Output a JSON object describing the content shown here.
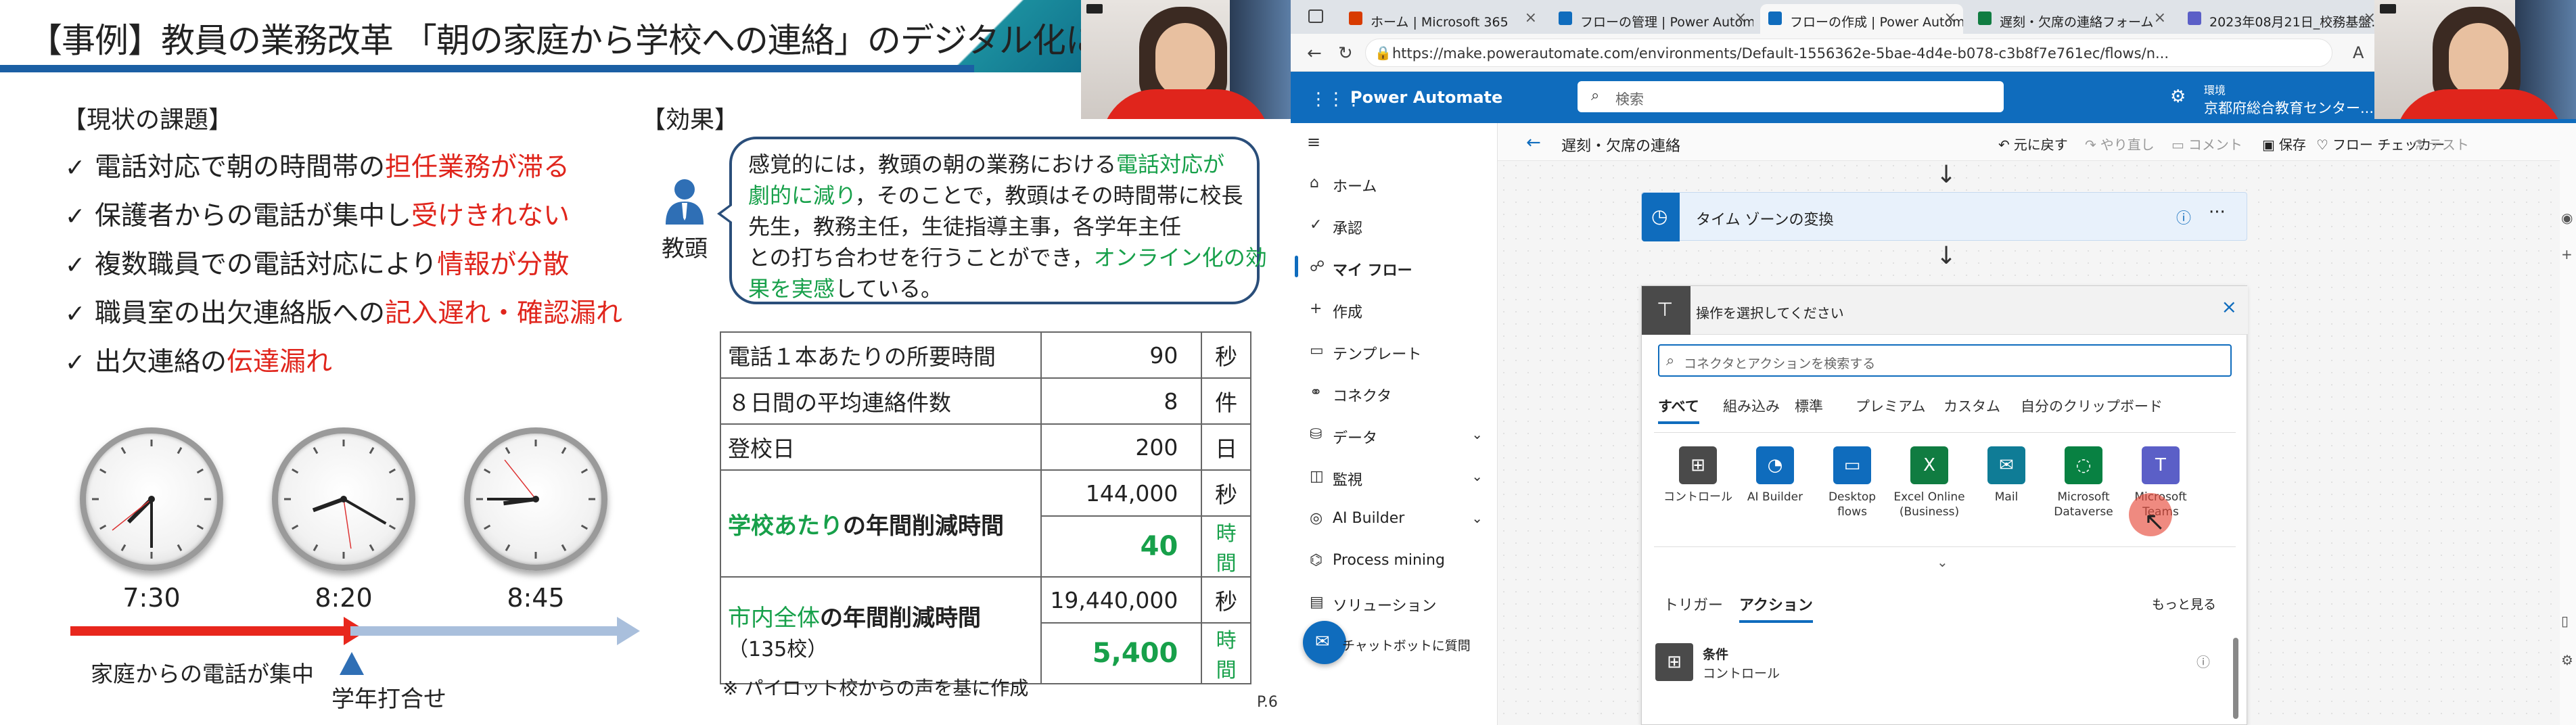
{
  "slide": {
    "title": "【事例】教員の業務改革 「朝の家庭から学校への連絡」のデジタル化による効果",
    "issues_heading": "【現状の課題】",
    "issues": [
      {
        "check": "✓",
        "text": "電話対応で朝の時間帯の",
        "highlight": "担任業務が滞る",
        "tail": ""
      },
      {
        "check": "✓",
        "text": "保護者からの電話が集中し",
        "highlight": "受けきれない",
        "tail": ""
      },
      {
        "check": "✓",
        "text": "複数職員での電話対応により",
        "highlight": "情報が分散",
        "tail": ""
      },
      {
        "check": "✓",
        "text": "職員室の出欠連絡版への",
        "highlight": "記入遅れ・確認漏れ",
        "tail": ""
      },
      {
        "check": "✓",
        "text": "出欠連絡の",
        "highlight": "伝達漏れ",
        "tail": ""
      }
    ],
    "clocks": [
      {
        "label": "7:30",
        "hour": 7,
        "minute": 30
      },
      {
        "label": "8:20",
        "hour": 8,
        "minute": 20
      },
      {
        "label": "8:45",
        "hour": 8,
        "minute": 45
      }
    ],
    "timeline": {
      "call_concentrated": "家庭からの電話が集中",
      "grade_meeting": "学年打合せ"
    },
    "effects_heading": "【効果】",
    "person_label": "教頭",
    "bubble": {
      "l1a": "感覚的には，教頭の朝の業務における",
      "l1b": "電話対応が",
      "l2a": "劇的に減り",
      "l2b": "，そのことで，教頭はその時間帯に校長",
      "l3": "先生，教務主任，生徒指導主事，各学年主任",
      "l4a": "との打ち合わせを行うことができ，",
      "l4b": "オンライン化の効",
      "l5a": "果を実感",
      "l5b": "している。"
    },
    "table": {
      "r1": {
        "label": "電話１本あたりの所要時間",
        "value": "90",
        "unit": "秒"
      },
      "r2": {
        "label": "８日間の平均連絡件数",
        "value": "8",
        "unit": "件"
      },
      "r3": {
        "label": "登校日",
        "value": "200",
        "unit": "日"
      },
      "r4": {
        "label_green": "学校あたり",
        "label_black": "の年間削減時間",
        "value_sec": "144,000",
        "unit_sec": "秒",
        "value_hr": "40",
        "unit_hr": "時間"
      },
      "r5": {
        "label_green": "市内全体",
        "label_black": "の年間削減時間",
        "label_sub": "（135校）",
        "value_sec": "19,440,000",
        "unit_sec": "秒",
        "value_hr": "5,400",
        "unit_hr": "時間"
      }
    },
    "note": "※ パイロット校からの声を基に作成",
    "page": "P.6"
  },
  "browser": {
    "tabs": [
      {
        "label": "ホーム | Microsoft 365",
        "color": "#d83b01"
      },
      {
        "label": "フローの管理 | Power Automate",
        "color": "#0f6cbd"
      },
      {
        "label": "フローの作成 | Power Automate",
        "color": "#0f6cbd"
      },
      {
        "label": "遅刻・欠席の連絡フォーム",
        "color": "#107c41"
      },
      {
        "label": "2023年08月21日_校務基盤...",
        "color": "#5b5fc7"
      }
    ],
    "url": "https://make.powerautomate.com/environments/Default-1556362e-5bae-4d4e-b078-c3b8f7e761ec/flows/n...",
    "app_name": "Power Automate",
    "search_placeholder": "検索",
    "env_label": "環境",
    "env_value": "京都府総合教育センター...",
    "nav": [
      {
        "icon": "⌂",
        "label": "ホーム"
      },
      {
        "icon": "✓",
        "label": "承認"
      },
      {
        "icon": "☍",
        "label": "マイ フロー",
        "selected": true
      },
      {
        "icon": "+",
        "label": "作成"
      },
      {
        "icon": "▭",
        "label": "テンプレート"
      },
      {
        "icon": "⚭",
        "label": "コネクタ"
      },
      {
        "icon": "⛁",
        "label": "データ",
        "chevron": true
      },
      {
        "icon": "◫",
        "label": "監視",
        "chevron": true
      },
      {
        "icon": "◎",
        "label": "AI Builder",
        "chevron": true
      },
      {
        "icon": "⌬",
        "label": "Process mining"
      },
      {
        "icon": "▤",
        "label": "ソリューション"
      }
    ],
    "chatbot_label": "チャットボットに質問",
    "flow_name": "遅刻・欠席の連絡",
    "commands": [
      {
        "label": "元に戻す",
        "icon": "↶",
        "enabled": true
      },
      {
        "label": "やり直し",
        "icon": "↷",
        "enabled": false
      },
      {
        "label": "コメント",
        "icon": "▭",
        "enabled": false
      },
      {
        "label": "保存",
        "icon": "▣",
        "enabled": true
      },
      {
        "label": "フロー チェッカー",
        "icon": "♡",
        "enabled": true
      },
      {
        "label": "テスト",
        "icon": "⚗",
        "enabled": false
      }
    ],
    "tz_card": "タイム ゾーンの変換",
    "action_panel": {
      "title": "操作を選択してください",
      "search_placeholder": "コネクタとアクションを検索する",
      "tabs": [
        "すべて",
        "組み込み",
        "標準",
        "プレミアム",
        "カスタム",
        "自分のクリップボード"
      ],
      "connectors": [
        {
          "label": "コントロール",
          "icon": "⊞",
          "color": "#4a4a4a"
        },
        {
          "label": "AI Builder",
          "icon": "◔",
          "color": "#0f6cbd"
        },
        {
          "label": "Desktop flows",
          "icon": "▭",
          "color": "#0f6cbd"
        },
        {
          "label": "Excel Online (Business)",
          "icon": "X",
          "color": "#107c41"
        },
        {
          "label": "Mail",
          "icon": "✉",
          "color": "#0f7c96"
        },
        {
          "label": "Microsoft Dataverse",
          "icon": "◌",
          "color": "#088142"
        },
        {
          "label": "Microsoft Teams",
          "icon": "T",
          "color": "#5b5fc7"
        }
      ],
      "sub_tabs": [
        "トリガー",
        "アクション"
      ],
      "see_more": "もっと見る",
      "item_name": "条件",
      "item_sub": "コントロール"
    }
  }
}
